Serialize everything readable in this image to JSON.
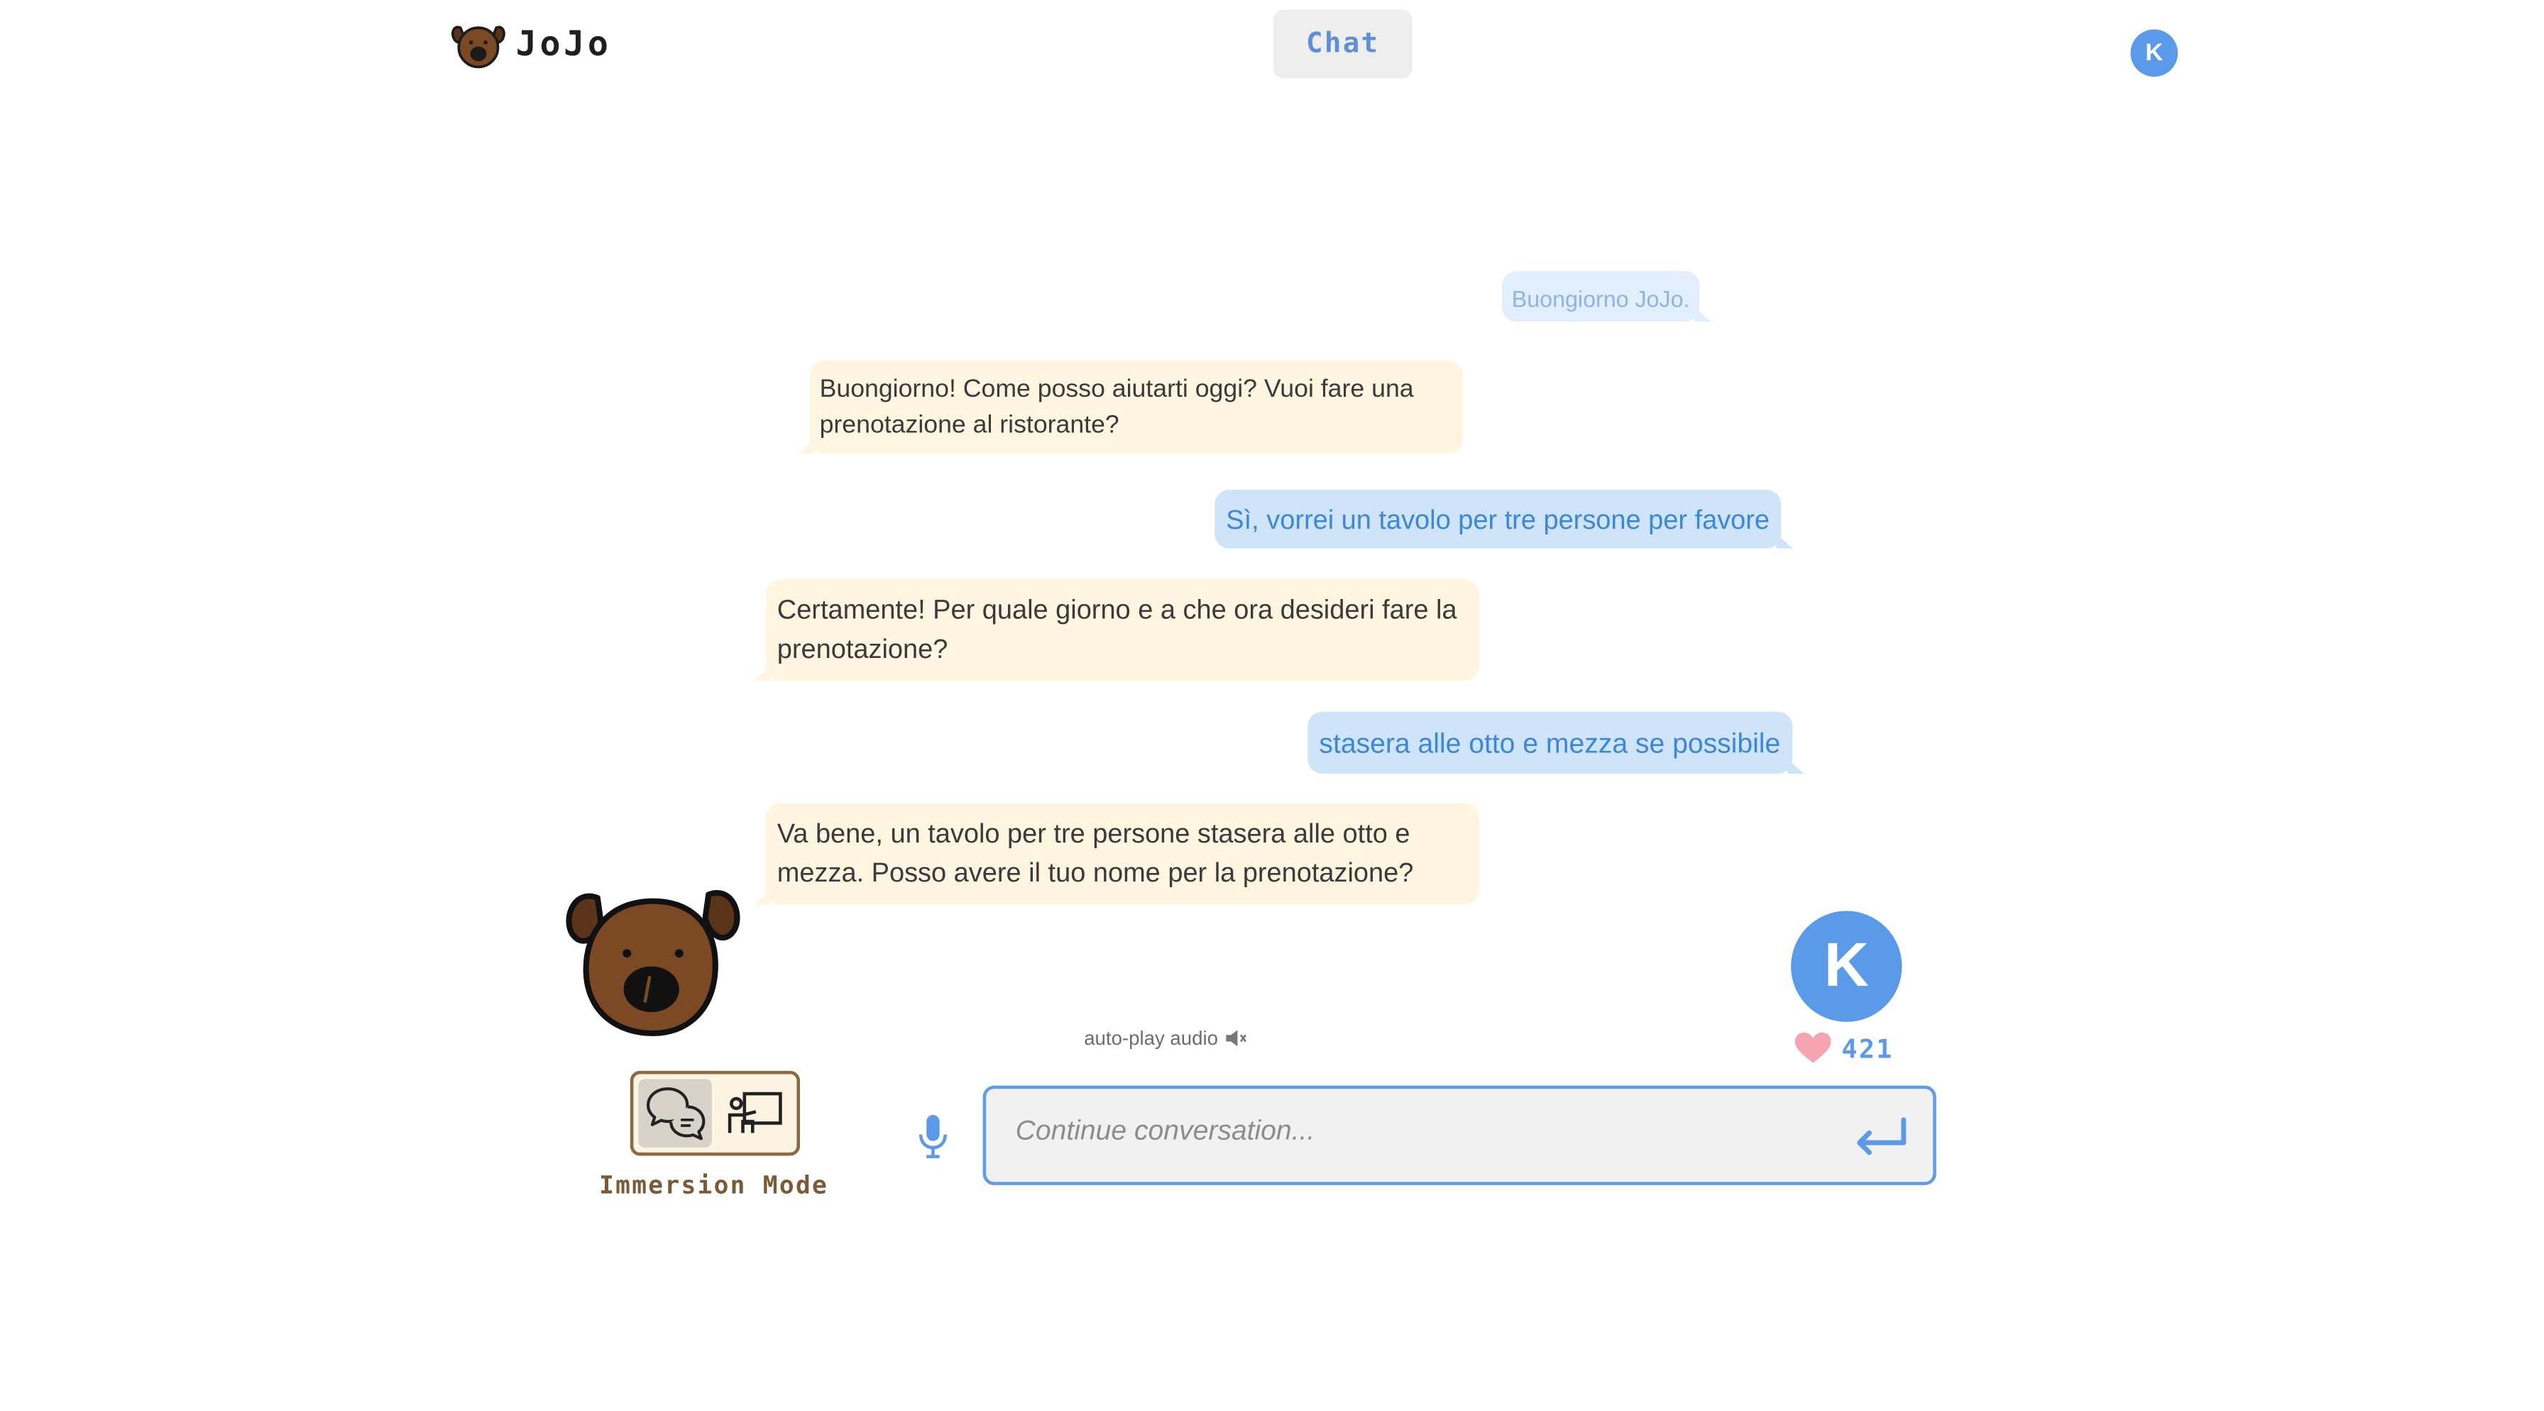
{
  "header": {
    "logo_text": "JoJo",
    "chat_tab_label": "Chat",
    "avatar_initial": "K"
  },
  "messages": [
    {
      "role": "user",
      "text": "Buongiorno JoJo."
    },
    {
      "role": "bot",
      "text": "Buongiorno! Come posso aiutarti oggi? Vuoi fare una prenotazione al ristorante?"
    },
    {
      "role": "user",
      "text": "Sì, vorrei un tavolo per tre persone per favore"
    },
    {
      "role": "bot",
      "text": "Certamente! Per quale giorno e a che ora desideri fare la prenotazione?"
    },
    {
      "role": "user",
      "text": "stasera alle otto e mezza se possibile"
    },
    {
      "role": "bot",
      "text": "Va bene, un tavolo per tre persone stasera alle otto e mezza. Posso avere il tuo nome per la prenotazione?"
    }
  ],
  "autoplay": {
    "label": "auto-play audio",
    "icon": "speaker-muted-icon"
  },
  "user": {
    "avatar_initial": "K",
    "heart_count": "421",
    "heart_icon": "heart-icon"
  },
  "mode_toggle": {
    "label": "Immersion Mode",
    "options": [
      {
        "icon": "chat-bubbles-icon",
        "active": true
      },
      {
        "icon": "teacher-board-icon",
        "active": false
      }
    ]
  },
  "input": {
    "placeholder": "Continue conversation...",
    "value": ""
  },
  "colors": {
    "accent_blue": "#5b9ae8",
    "user_bubble": "#cfe4f9",
    "bot_bubble": "#fff5e0",
    "mascot_brown": "#7b4a25"
  }
}
